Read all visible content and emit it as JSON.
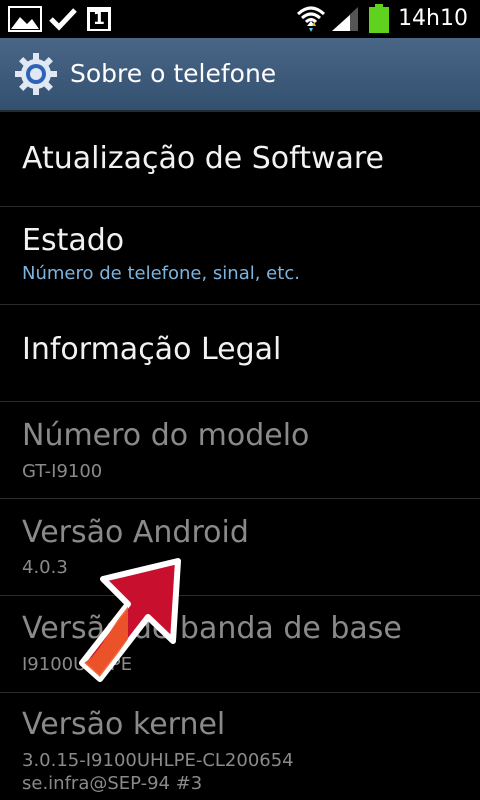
{
  "status_bar": {
    "time": "14h10",
    "notification_badge": "1",
    "icons": [
      "image-icon",
      "check-icon",
      "calendar-icon",
      "wifi-icon",
      "signal-icon",
      "battery-icon"
    ],
    "battery_color": "#5fd21e"
  },
  "action_bar": {
    "title": "Sobre o telefone",
    "icon": "gear-icon",
    "background": "#3f5b7c"
  },
  "items": [
    {
      "title": "Atualização de Software",
      "subtitle": ""
    },
    {
      "title": "Estado",
      "subtitle": "Número de telefone, sinal, etc."
    },
    {
      "title": "Informação Legal",
      "subtitle": ""
    },
    {
      "title": "Número do modelo",
      "subtitle": "GT-I9100"
    },
    {
      "title": "Versão Android",
      "subtitle": "4.0.3"
    },
    {
      "title": "Versão de banda de base",
      "subtitle": "I9100UHLPE"
    },
    {
      "title": "Versão kernel",
      "subtitle": "3.0.15-I9100UHLPE-CL200654",
      "subtitle2": "se.infra@SEP-94 #3"
    }
  ],
  "overlay": {
    "arrow_color": "#c8102e",
    "arrow_icon": "red-arrow-icon"
  }
}
